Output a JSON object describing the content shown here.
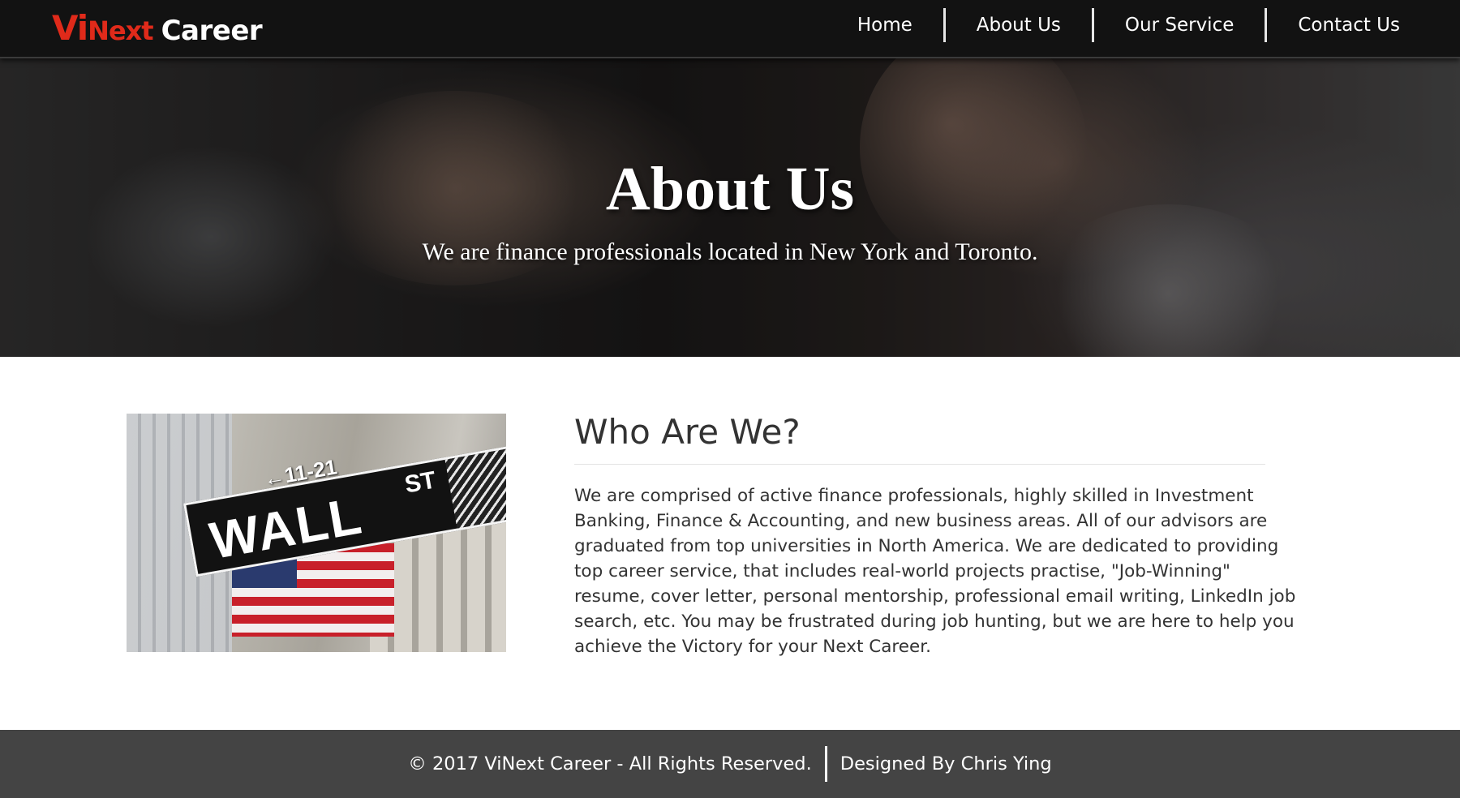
{
  "brand": {
    "vi": "Vi",
    "next": "Next",
    "career": "Career",
    "accent_color": "#e02a1a"
  },
  "nav": {
    "items": [
      {
        "label": "Home"
      },
      {
        "label": "About Us"
      },
      {
        "label": "Our Service"
      },
      {
        "label": "Contact Us"
      }
    ]
  },
  "hero": {
    "title": "About Us",
    "subtitle": "We are finance professionals located in New York and Toronto."
  },
  "content": {
    "image": {
      "icon": "wall-street-sign-photo",
      "sign_arrow": "←11-21",
      "sign_main": "WALL",
      "sign_st": "ST"
    },
    "heading": "Who Are We?",
    "body": "We are comprised of active finance professionals, highly skilled in Investment Banking, Finance & Accounting, and new business areas. All of our advisors are graduated from top universities in North America. We are dedicated to providing top career service, that includes real-world projects practise, \"Job-Winning\" resume, cover letter, personal mentorship, professional email writing, LinkedIn job search, etc. You may be frustrated during job hunting, but we are here to help you achieve the Victory for your Next Career."
  },
  "footer": {
    "copyright": "© 2017 ViNext Career - All Rights Reserved.",
    "designer": "Designed By Chris Ying",
    "background_color": "#444444"
  }
}
